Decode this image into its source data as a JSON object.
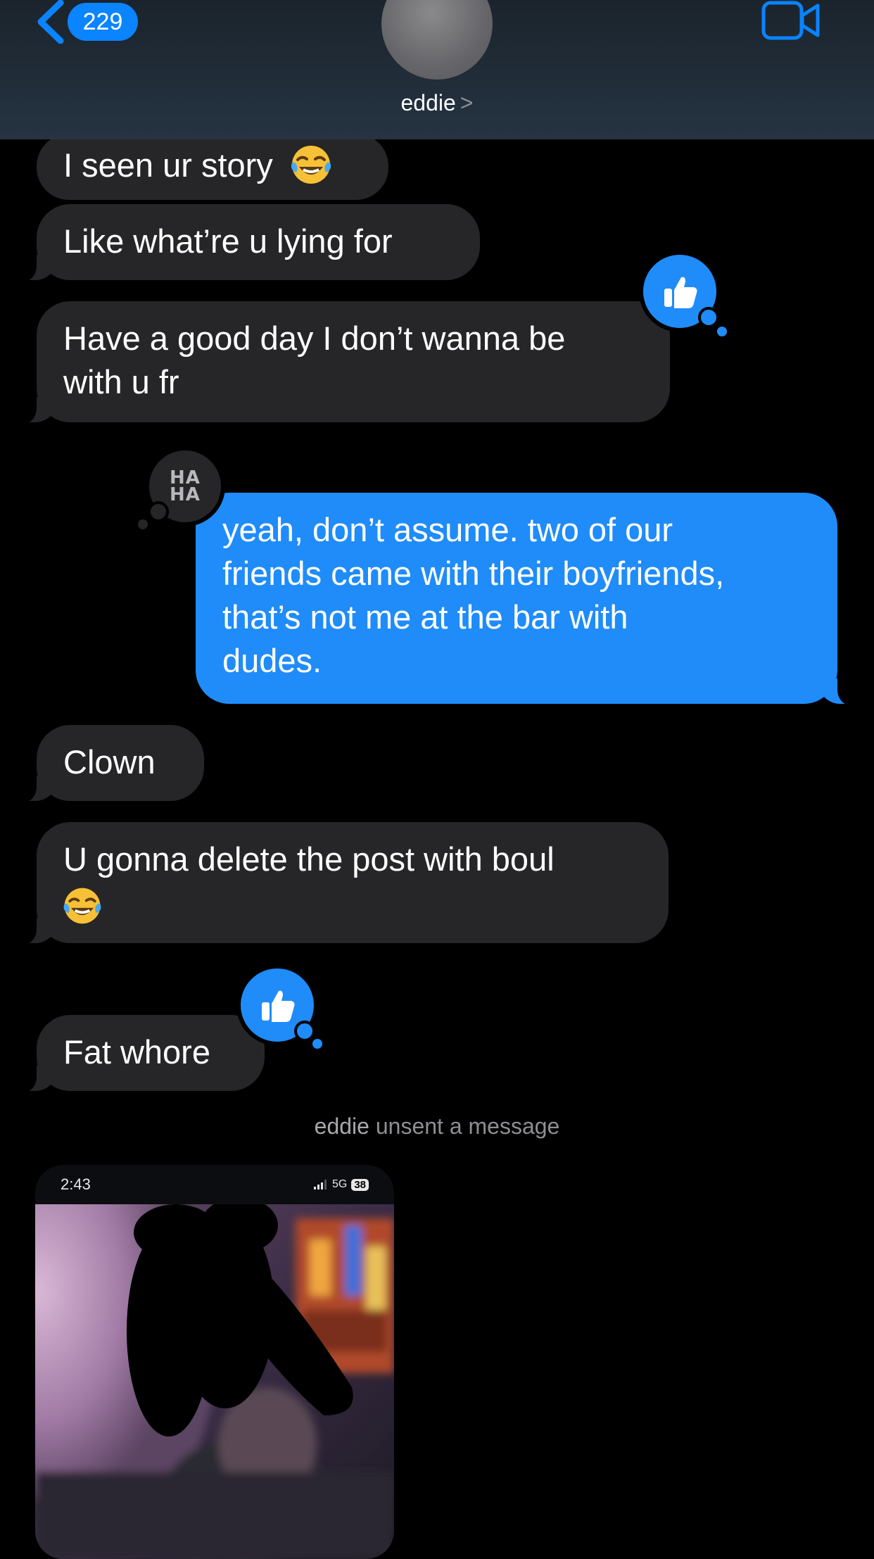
{
  "header": {
    "unread_count": "229",
    "contact_name": "eddie",
    "contact_chevron": ">"
  },
  "messages": [
    {
      "from": "them",
      "text": "I seen ur story",
      "emoji": "face-with-tears-of-joy"
    },
    {
      "from": "them",
      "text": "Like what’re u lying for"
    },
    {
      "from": "them",
      "lines": [
        "Have a good day I don’t wanna be",
        "with u fr"
      ],
      "tapback": "thumbs-up"
    },
    {
      "from": "me",
      "lines": [
        "yeah, don’t assume. two of our",
        "friends came with their boyfriends,",
        "that’s not me at the bar with",
        "dudes."
      ],
      "tapback_label": [
        "HA",
        "HA"
      ]
    },
    {
      "from": "them",
      "text": "Clown"
    },
    {
      "from": "them",
      "lines": [
        "U gonna delete the post with boul"
      ],
      "emoji": "face-with-tears-of-joy"
    },
    {
      "from": "them",
      "text": "Fat whore",
      "tapback": "thumbs-up"
    }
  ],
  "unsent_notice": {
    "name": "eddie",
    "text": "unsent a message"
  },
  "screenshot_attachment": {
    "time": "2:43",
    "network": "5G",
    "battery": "38"
  },
  "colors": {
    "accent": "#0a84ff",
    "outgoing_bubble": "#1f8cf9",
    "incoming_bubble": "#262628",
    "background": "#000000"
  }
}
